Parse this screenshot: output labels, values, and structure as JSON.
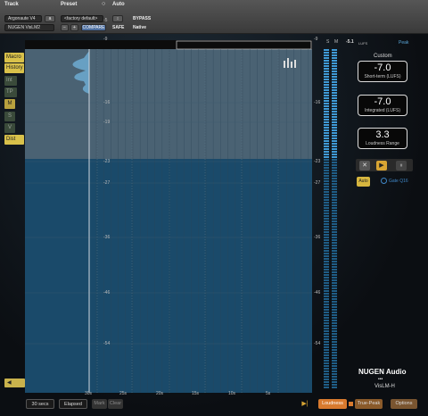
{
  "host": {
    "track_label": "Track",
    "preset_label": "Preset",
    "auto_label": "Auto",
    "track_name": "Argonaute V4",
    "track_sel": "a",
    "preset_name": "<factory default>",
    "plugin_name": "NUGEN VisLM2",
    "minus": "−",
    "plus": "+",
    "compare": "COMPARE",
    "bypass": "BYPASS",
    "safe": "SAFE",
    "native": "Native",
    "ab": "↕"
  },
  "left_buttons": [
    "Macro",
    "History",
    "Int",
    "TP",
    "M",
    "S",
    "V",
    "Dist"
  ],
  "right_readouts": [
    {
      "value": "-7.0",
      "caption": "Short-term (LUFS)"
    },
    {
      "value": "-7.0",
      "caption": "Integrated (LUFS)"
    },
    {
      "value": "3.3",
      "caption": "Loudness Range"
    }
  ],
  "meter": {
    "top_value": "-5.1",
    "s_label": "S",
    "m_label": "M",
    "unit_label": "LUFS",
    "peak_label": "Peak",
    "custom_label": "Custom"
  },
  "scale": [
    "-5",
    "-9",
    "-16",
    "-19",
    "-23",
    "-27",
    "-36",
    "-46",
    "-54"
  ],
  "scale_right": [
    "-9",
    "-16",
    "-23",
    "-27",
    "-36",
    "-46",
    "-54"
  ],
  "time_axis": [
    "30s",
    "25s",
    "20s",
    "15s",
    "10s",
    "5s"
  ],
  "controls": {
    "stop": "✕",
    "play": "▶",
    "pause": "⏸",
    "auto": "Auto",
    "gate": "Gate Q16",
    "back": "◀"
  },
  "bottom": {
    "duration": "30 secs",
    "elapsed": "Elapsed",
    "mark": "Mark",
    "clear": "Clear",
    "end": "▶|",
    "loudness": "Loudness",
    "true_peak": "True-Peak",
    "options": "Options"
  },
  "branding": {
    "brand": "NUGEN Audio",
    "dots": "•••",
    "product": "VisLM-H"
  },
  "series_level": [
    -6.2,
    -6.8,
    -6.4,
    -7.1,
    -6.5,
    -7.3,
    -6.9,
    -6.6,
    -7.5,
    -6.8,
    -6.4,
    -7.2,
    -6.9,
    -6.5,
    -7.4,
    -6.7,
    -6.3,
    -7.0,
    -6.8,
    -7.6,
    -6.5,
    -6.9,
    -7.2,
    -6.6,
    -7.1,
    -6.4,
    -6.8,
    -7.3,
    -6.7,
    -6.5,
    -7.0,
    -6.9,
    -6.6,
    -7.4,
    -6.8,
    -6.5,
    -7.1,
    -6.7,
    -6.4,
    -7.0,
    -6.8,
    -7.5,
    -6.6,
    -6.9,
    -7.2,
    -6.5,
    -8.4,
    -6.8,
    -7.0,
    -6.6,
    -7.3,
    -6.9,
    -6.4,
    -7.1,
    -6.7,
    -6.5,
    -7.2,
    -6.8,
    -6.6,
    -7.0
  ]
}
